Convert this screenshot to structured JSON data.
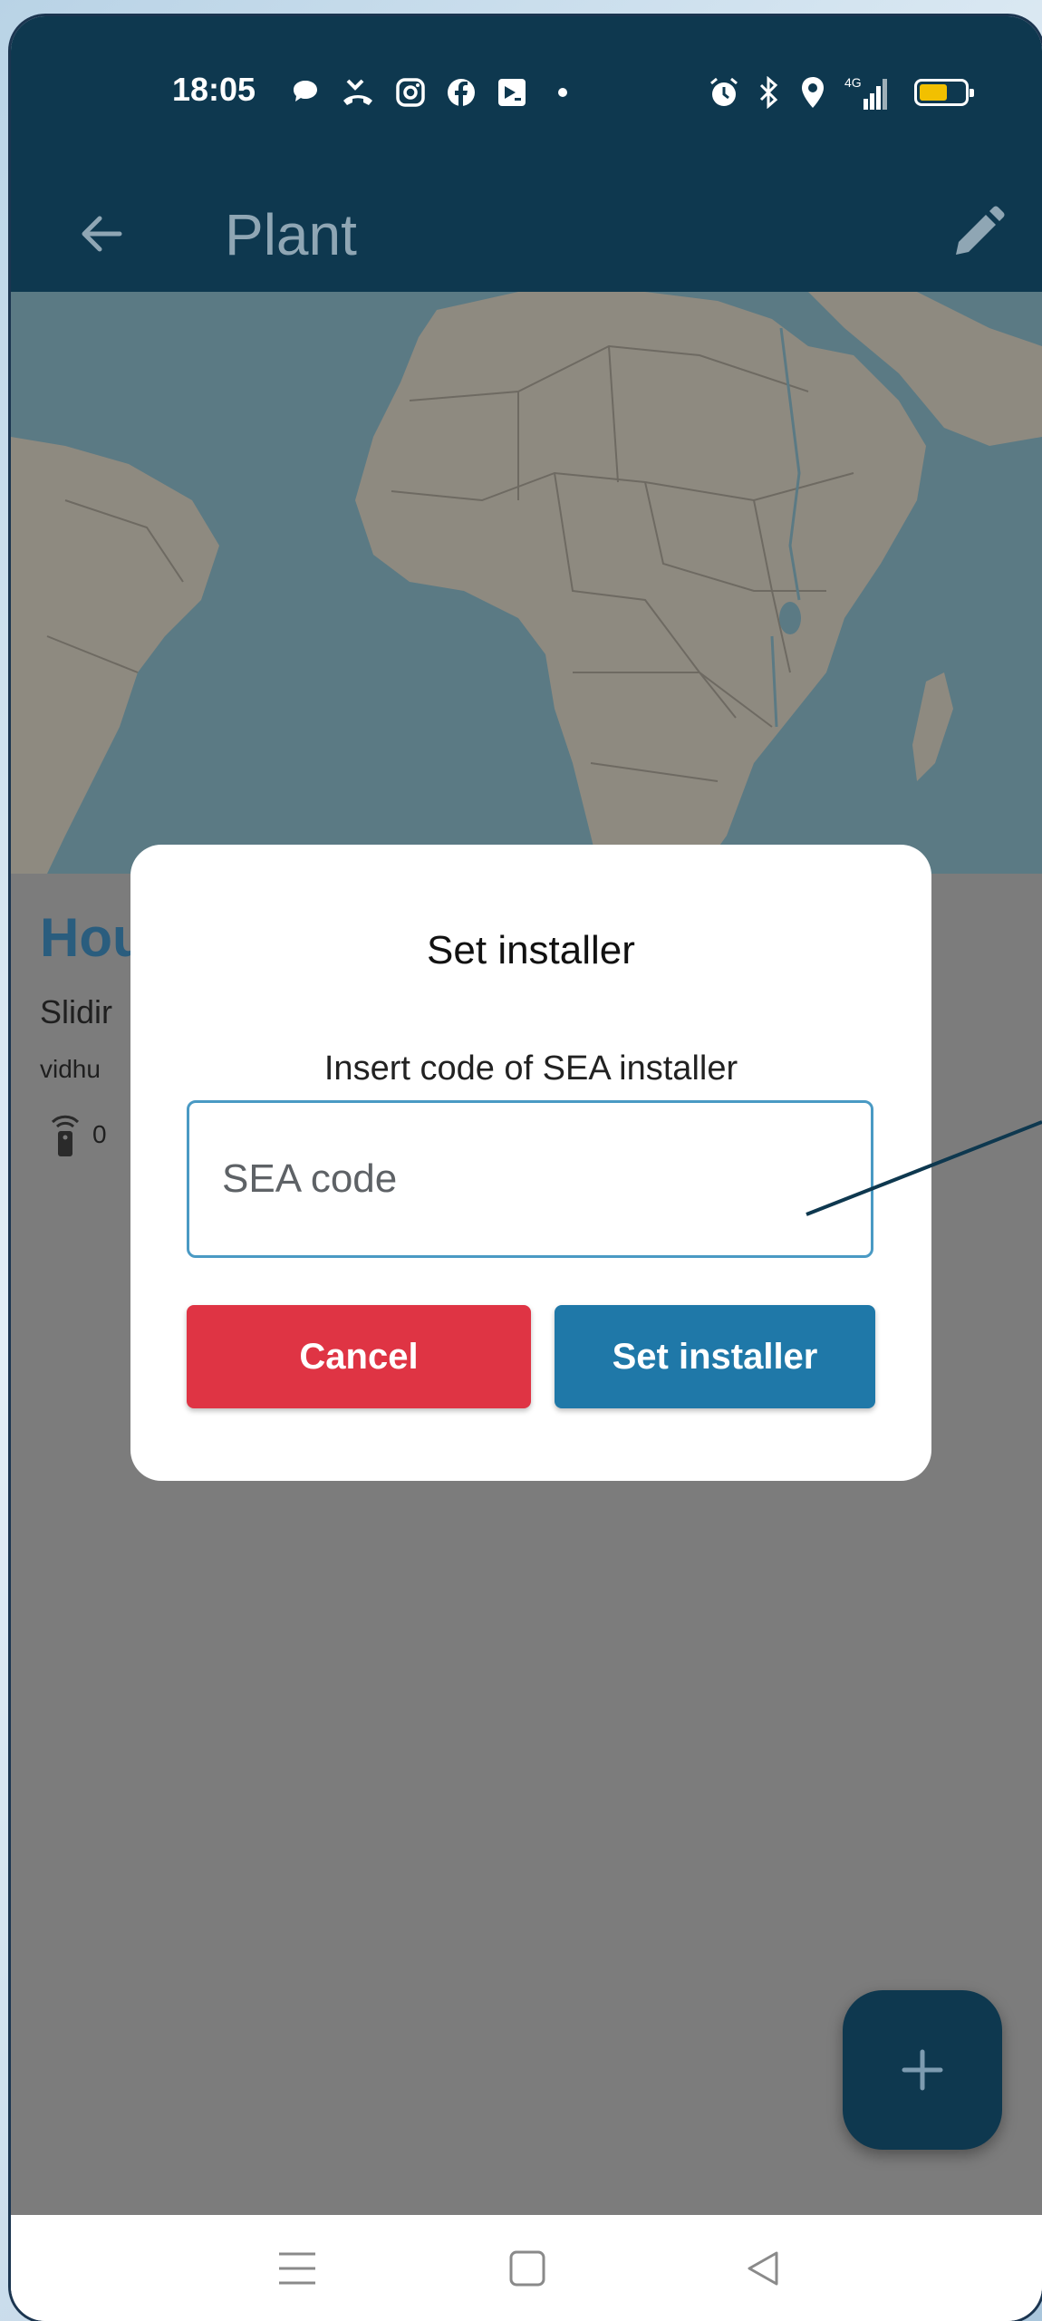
{
  "status_bar": {
    "time": "18:05",
    "left_icons": [
      "chat-bubble-icon",
      "missed-call-icon",
      "instagram-icon",
      "facebook-icon",
      "news-icon",
      "dot-icon"
    ],
    "right_icons": [
      "alarm-icon",
      "bluetooth-icon",
      "location-icon",
      "signal-4g-icon",
      "battery-icon"
    ],
    "network_label": "4G",
    "battery_color": "#f2c000"
  },
  "app_bar": {
    "title": "Plant",
    "back_icon": "arrow-back-icon",
    "edit_icon": "pencil-icon",
    "color": "#0e384f"
  },
  "plant": {
    "name": "Hou",
    "subtitle": "Slidir",
    "owner": "vidhu",
    "remote_count": "0"
  },
  "dialog": {
    "title": "Set installer",
    "message": "Insert code of SEA installer",
    "input_placeholder": "SEA code",
    "input_value": "",
    "cancel_label": "Cancel",
    "confirm_label": "Set installer",
    "cancel_color": "#df3444",
    "confirm_color": "#1f78a8"
  },
  "fab": {
    "icon": "plus-icon"
  },
  "nav_bar": {
    "items": [
      "menu-icon",
      "home-square-icon",
      "back-triangle-icon"
    ]
  }
}
